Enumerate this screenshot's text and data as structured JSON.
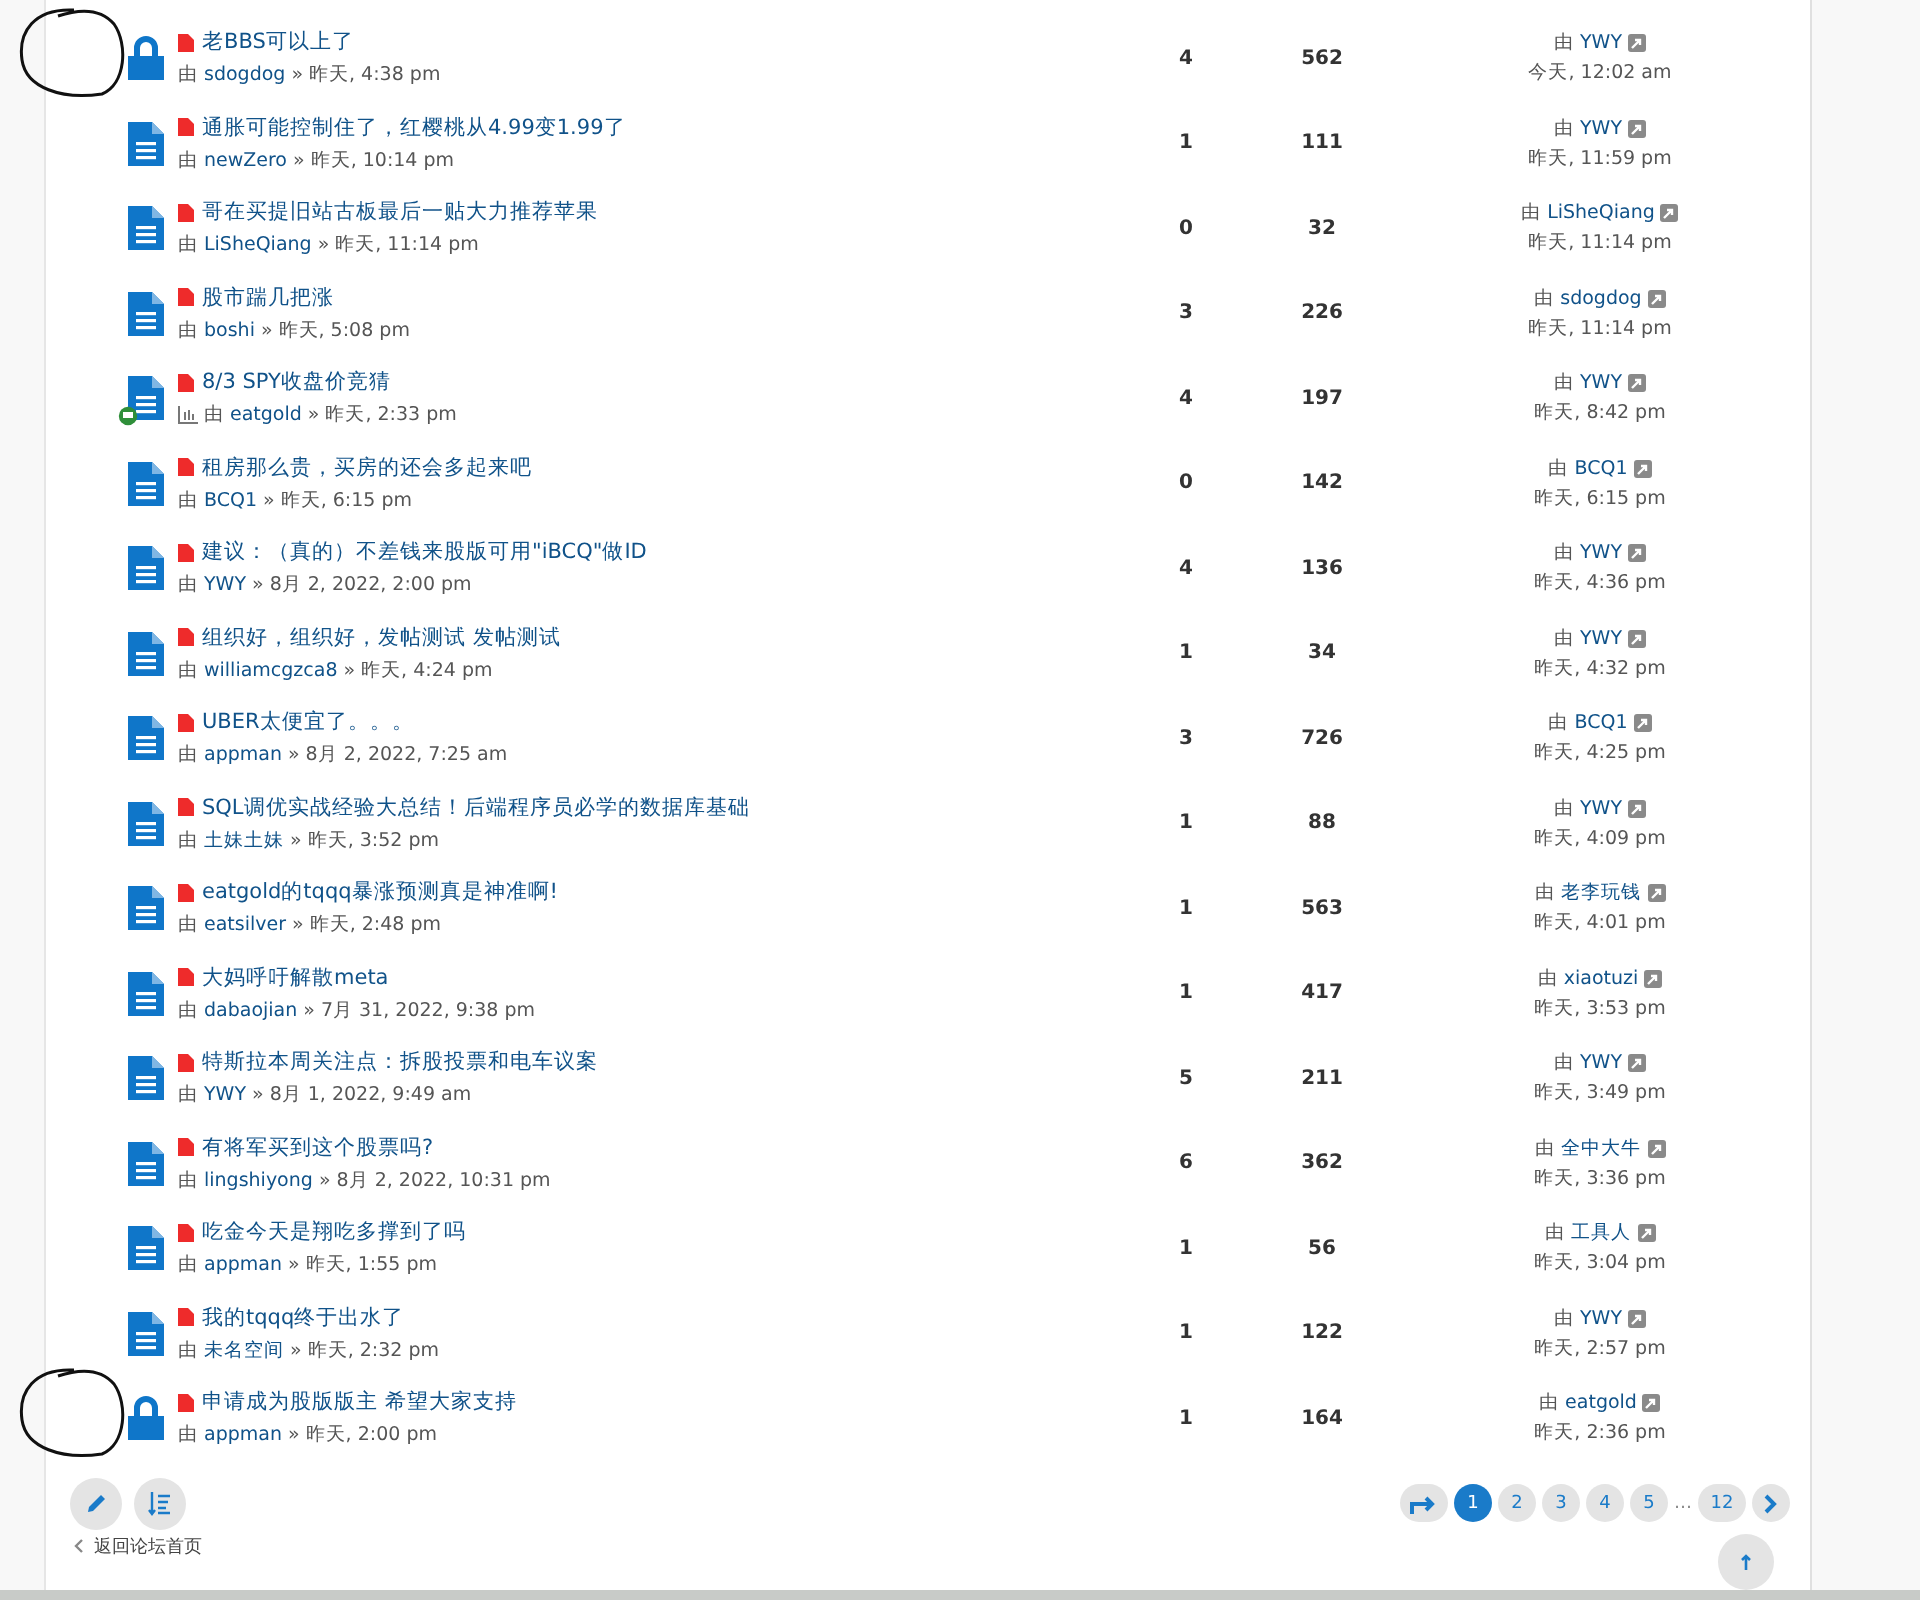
{
  "topics": [
    {
      "kind": "locked",
      "circled": true,
      "poll": false,
      "title": "老BBS可以上了",
      "by": "由",
      "author": "sdogdog",
      "sep": "»",
      "time": "昨天, 4:38 pm",
      "replies": "4",
      "views": "562",
      "last_prefix": "由",
      "last_by": "YWY",
      "last_time": "今天, 12:02 am"
    },
    {
      "kind": "normal",
      "circled": false,
      "poll": false,
      "title": "通胀可能控制住了，红樱桃从4.99变1.99了",
      "by": "由",
      "author": "newZero",
      "sep": "»",
      "time": "昨天, 10:14 pm",
      "replies": "1",
      "views": "111",
      "last_prefix": "由",
      "last_by": "YWY",
      "last_time": "昨天, 11:59 pm"
    },
    {
      "kind": "normal",
      "circled": false,
      "poll": false,
      "title": "哥在买提旧站古板最后一贴大力推荐苹果",
      "by": "由",
      "author": "LiSheQiang",
      "sep": "»",
      "time": "昨天, 11:14 pm",
      "replies": "0",
      "views": "32",
      "last_prefix": "由",
      "last_by": "LiSheQiang",
      "last_time": "昨天, 11:14 pm"
    },
    {
      "kind": "normal",
      "circled": false,
      "poll": false,
      "title": "股市踹几把涨",
      "by": "由",
      "author": "boshi",
      "sep": "»",
      "time": "昨天, 5:08 pm",
      "replies": "3",
      "views": "226",
      "last_prefix": "由",
      "last_by": "sdogdog",
      "last_time": "昨天, 11:14 pm"
    },
    {
      "kind": "normal",
      "circled": false,
      "poll": true,
      "title": "8/3 SPY收盘价竞猜",
      "by": "由",
      "author": "eatgold",
      "sep": "»",
      "time": "昨天, 2:33 pm",
      "replies": "4",
      "views": "197",
      "last_prefix": "由",
      "last_by": "YWY",
      "last_time": "昨天, 8:42 pm"
    },
    {
      "kind": "normal",
      "circled": false,
      "poll": false,
      "title": "租房那么贵，买房的还会多起来吧",
      "by": "由",
      "author": "BCQ1",
      "sep": "»",
      "time": "昨天, 6:15 pm",
      "replies": "0",
      "views": "142",
      "last_prefix": "由",
      "last_by": "BCQ1",
      "last_time": "昨天, 6:15 pm"
    },
    {
      "kind": "normal",
      "circled": false,
      "poll": false,
      "title": "建议：（真的）不差钱来股版可用\"iBCQ\"做ID",
      "by": "由",
      "author": "YWY",
      "sep": "»",
      "time": "8月 2, 2022, 2:00 pm",
      "replies": "4",
      "views": "136",
      "last_prefix": "由",
      "last_by": "YWY",
      "last_time": "昨天, 4:36 pm"
    },
    {
      "kind": "normal",
      "circled": false,
      "poll": false,
      "title": "组织好，组织好，发帖测试 发帖测试",
      "by": "由",
      "author": "williamcgzca8",
      "sep": "»",
      "time": "昨天, 4:24 pm",
      "replies": "1",
      "views": "34",
      "last_prefix": "由",
      "last_by": "YWY",
      "last_time": "昨天, 4:32 pm"
    },
    {
      "kind": "normal",
      "circled": false,
      "poll": false,
      "title": "UBER太便宜了。。。",
      "by": "由",
      "author": "appman",
      "sep": "»",
      "time": "8月 2, 2022, 7:25 am",
      "replies": "3",
      "views": "726",
      "last_prefix": "由",
      "last_by": "BCQ1",
      "last_time": "昨天, 4:25 pm"
    },
    {
      "kind": "normal",
      "circled": false,
      "poll": false,
      "title": "SQL调优实战经验大总结！后端程序员必学的数据库基础",
      "by": "由",
      "author": "土妹土妹",
      "sep": "»",
      "time": "昨天, 3:52 pm",
      "replies": "1",
      "views": "88",
      "last_prefix": "由",
      "last_by": "YWY",
      "last_time": "昨天, 4:09 pm"
    },
    {
      "kind": "normal",
      "circled": false,
      "poll": false,
      "title": "eatgold的tqqq暴涨预测真是神准啊!",
      "by": "由",
      "author": "eatsilver",
      "sep": "»",
      "time": "昨天, 2:48 pm",
      "replies": "1",
      "views": "563",
      "last_prefix": "由",
      "last_by": "老李玩钱",
      "last_time": "昨天, 4:01 pm"
    },
    {
      "kind": "normal",
      "circled": false,
      "poll": false,
      "title": "大妈呼吁解散meta",
      "by": "由",
      "author": "dabaojian",
      "sep": "»",
      "time": "7月 31, 2022, 9:38 pm",
      "replies": "1",
      "views": "417",
      "last_prefix": "由",
      "last_by": "xiaotuzi",
      "last_time": "昨天, 3:53 pm"
    },
    {
      "kind": "normal",
      "circled": false,
      "poll": false,
      "title": "特斯拉本周关注点：拆股投票和电车议案",
      "by": "由",
      "author": "YWY",
      "sep": "»",
      "time": "8月 1, 2022, 9:49 am",
      "replies": "5",
      "views": "211",
      "last_prefix": "由",
      "last_by": "YWY",
      "last_time": "昨天, 3:49 pm"
    },
    {
      "kind": "normal",
      "circled": false,
      "poll": false,
      "title": "有将军买到这个股票吗?",
      "by": "由",
      "author": "lingshiyong",
      "sep": "»",
      "time": "8月 2, 2022, 10:31 pm",
      "replies": "6",
      "views": "362",
      "last_prefix": "由",
      "last_by": "全中大牛",
      "last_time": "昨天, 3:36 pm"
    },
    {
      "kind": "normal",
      "circled": false,
      "poll": false,
      "title": "吃金今天是翔吃多撑到了吗",
      "by": "由",
      "author": "appman",
      "sep": "»",
      "time": "昨天, 1:55 pm",
      "replies": "1",
      "views": "56",
      "last_prefix": "由",
      "last_by": "工具人",
      "last_time": "昨天, 3:04 pm"
    },
    {
      "kind": "normal",
      "circled": false,
      "poll": false,
      "title": "我的tqqq终于出水了",
      "by": "由",
      "author": "未名空间",
      "sep": "»",
      "time": "昨天, 2:32 pm",
      "replies": "1",
      "views": "122",
      "last_prefix": "由",
      "last_by": "YWY",
      "last_time": "昨天, 2:57 pm"
    },
    {
      "kind": "locked",
      "circled": true,
      "poll": false,
      "title": "申请成为股版版主 希望大家支持",
      "by": "由",
      "author": "appman",
      "sep": "»",
      "time": "昨天, 2:00 pm",
      "replies": "1",
      "views": "164",
      "last_prefix": "由",
      "last_by": "eatgold",
      "last_time": "昨天, 2:36 pm"
    }
  ],
  "pagination": [
    {
      "label": "1",
      "selected": true
    },
    {
      "label": "2",
      "selected": false
    },
    {
      "label": "3",
      "selected": false
    },
    {
      "label": "4",
      "selected": false
    },
    {
      "label": "5",
      "selected": false
    },
    {
      "label": "…",
      "kind": "gap"
    },
    {
      "label": "12",
      "selected": false
    }
  ],
  "back_link": "返回论坛首页"
}
